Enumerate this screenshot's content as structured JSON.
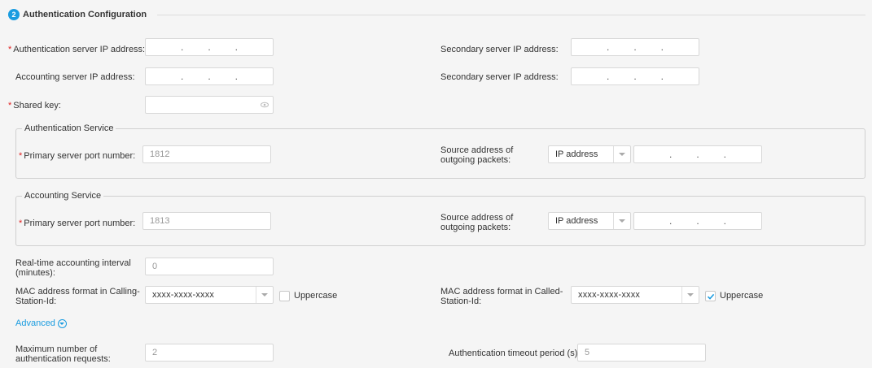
{
  "section": {
    "step": "2",
    "title": "Authentication Configuration"
  },
  "fields": {
    "auth_server_ip": {
      "label": "Authentication server IP address:"
    },
    "secondary_ip_1": {
      "label": "Secondary server IP address:"
    },
    "acct_server_ip": {
      "label": "Accounting server IP address:"
    },
    "secondary_ip_2": {
      "label": "Secondary server IP address:"
    },
    "shared_key": {
      "label": "Shared key:"
    }
  },
  "auth_service": {
    "legend": "Authentication Service",
    "port_label": "Primary server port number:",
    "port_value": "1812",
    "source_label_1": "Source address of",
    "source_label_2": "outgoing packets:",
    "source_type": "IP address"
  },
  "acct_service": {
    "legend": "Accounting Service",
    "port_label": "Primary server port number:",
    "port_value": "1813",
    "source_label_1": "Source address of",
    "source_label_2": "outgoing packets:",
    "source_type": "IP address"
  },
  "realtime": {
    "label_1": "Real-time accounting interval",
    "label_2": "(minutes):",
    "value": "0"
  },
  "mac_calling": {
    "label_1": "MAC address format in Calling-",
    "label_2": "Station-Id:",
    "value": "xxxx-xxxx-xxxx",
    "uppercase_label": "Uppercase",
    "uppercase_checked": false
  },
  "mac_called": {
    "label_1": "MAC address format in Called-",
    "label_2": "Station-Id:",
    "value": "xxxx-xxxx-xxxx",
    "uppercase_label": "Uppercase",
    "uppercase_checked": true
  },
  "advanced": {
    "label": "Advanced"
  },
  "max_requests": {
    "label_1": "Maximum number of",
    "label_2": "authentication requests:",
    "value": "2"
  },
  "timeout": {
    "label": "Authentication timeout period (s):",
    "value": "5"
  },
  "ip_dot": ".",
  "colors": {
    "accent": "#1a9ce0",
    "required": "#e02020"
  }
}
